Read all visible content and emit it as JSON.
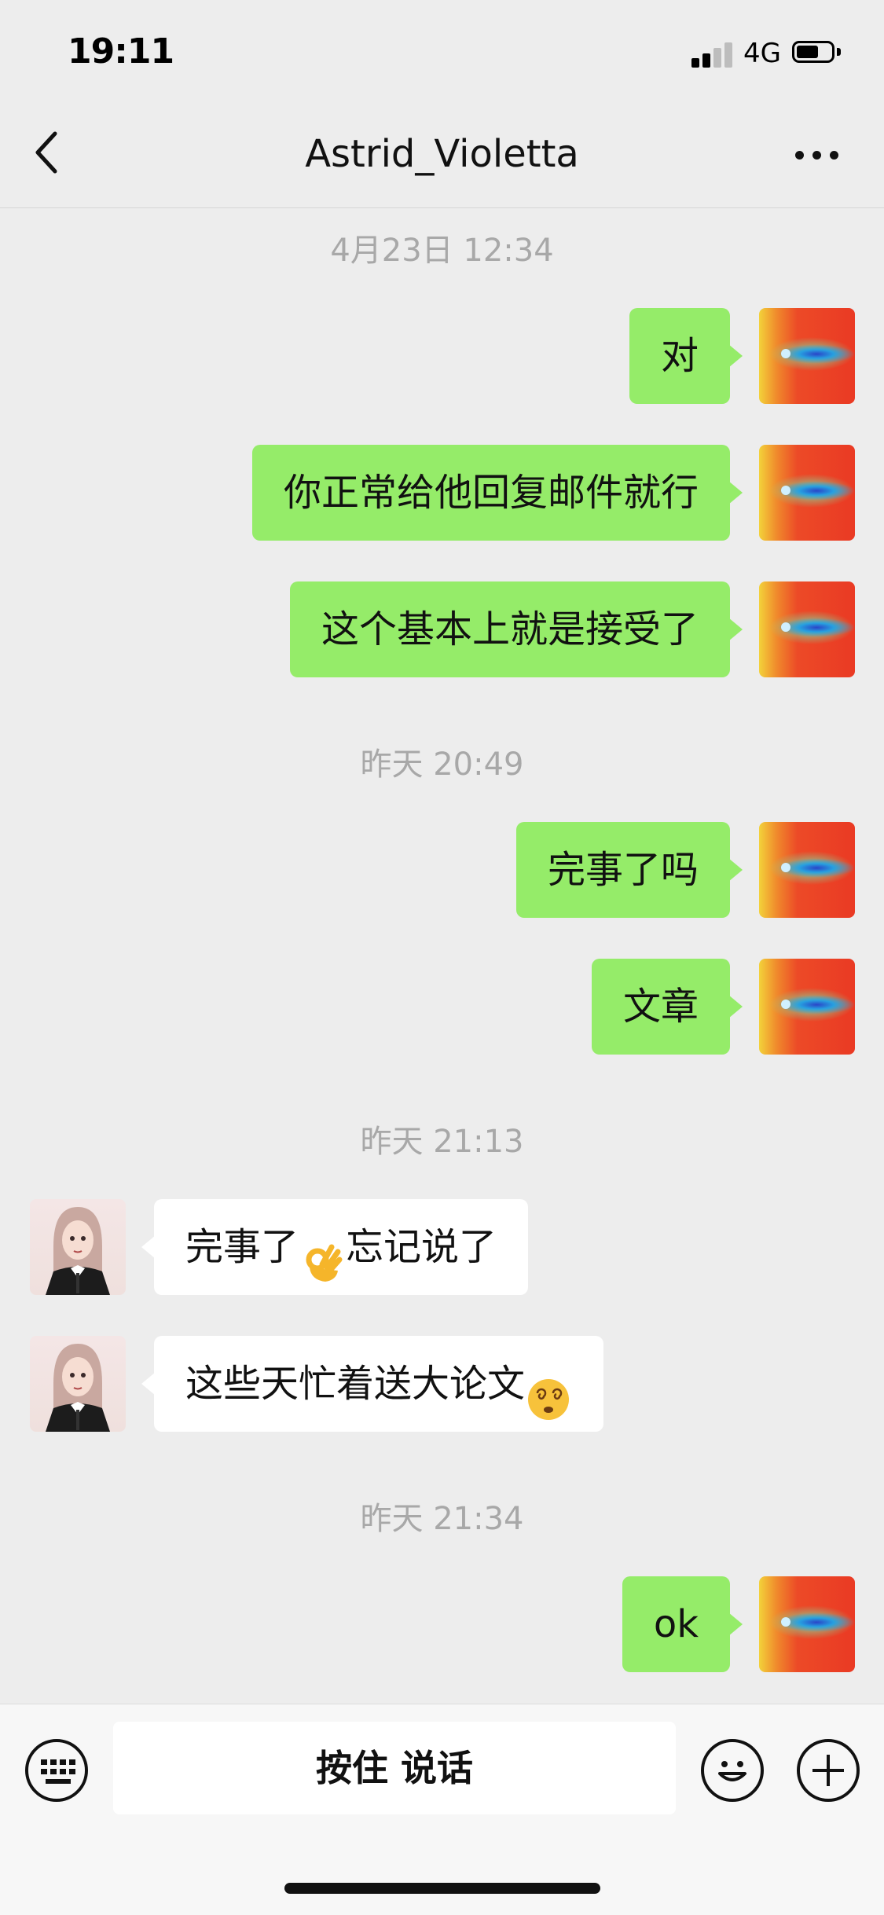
{
  "status_bar": {
    "time": "19:11",
    "network": "4G"
  },
  "header": {
    "title": "Astrid_Violetta"
  },
  "timestamps": [
    "4月23日 12:34",
    "昨天 20:49",
    "昨天 21:13",
    "昨天 21:34"
  ],
  "messages": [
    {
      "sender": "me",
      "text": "对"
    },
    {
      "sender": "me",
      "text": "你正常给他回复邮件就行"
    },
    {
      "sender": "me",
      "text": "这个基本上就是接受了"
    },
    {
      "sender": "me",
      "text": "完事了吗"
    },
    {
      "sender": "me",
      "text": "文章"
    },
    {
      "sender": "contact",
      "text_before": "完事了",
      "emoji": "ok-hand-emoji",
      "text_after": "忘记说了"
    },
    {
      "sender": "contact",
      "text_before": "这些天忙着送大论文",
      "emoji": "dizzy-face-emoji",
      "text_after": ""
    },
    {
      "sender": "me",
      "text": "ok"
    }
  ],
  "input_bar": {
    "hold_to_talk_label": "按住 说话"
  },
  "colors": {
    "background": "#ededed",
    "my_bubble": "#95ec69",
    "their_bubble": "#ffffff",
    "timestamp": "#a8a8a8"
  },
  "icons": [
    "back-chevron-icon",
    "more-dots-icon",
    "keyboard-icon",
    "emoji-icon",
    "plus-icon"
  ]
}
